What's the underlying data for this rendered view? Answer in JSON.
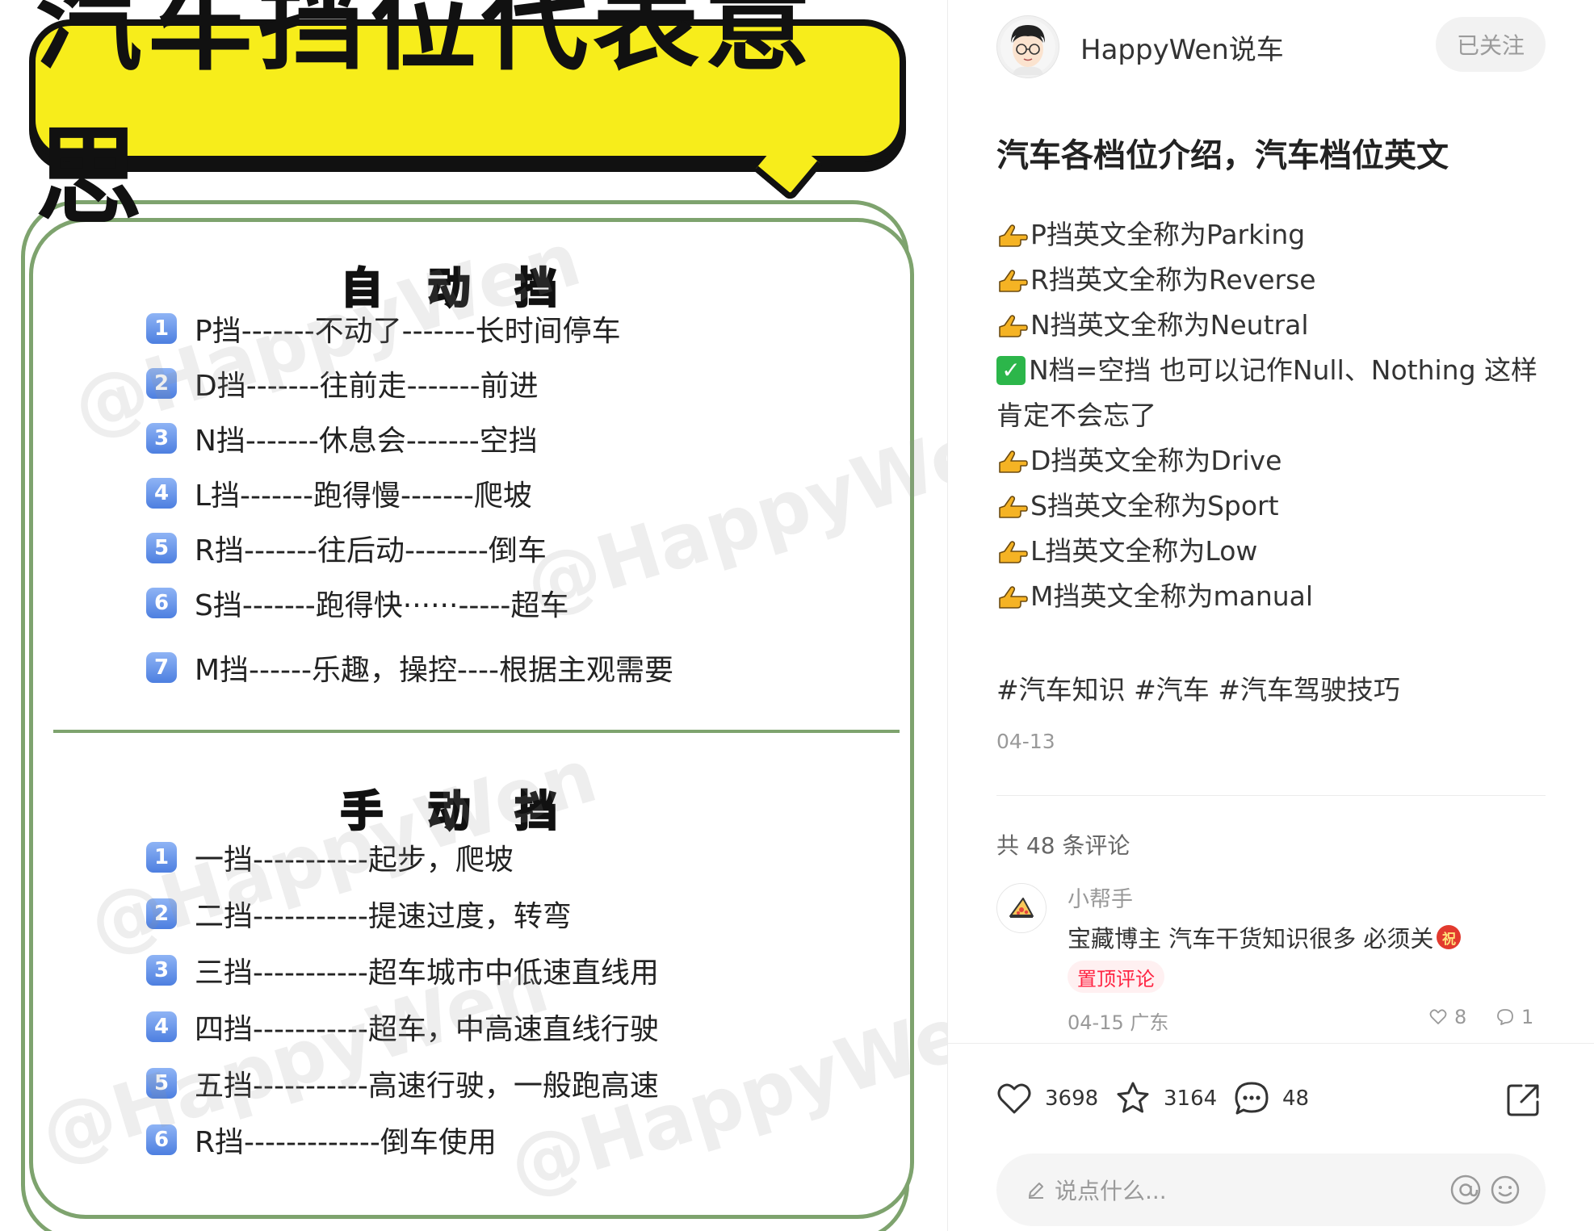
{
  "image": {
    "title": "汽车挡位代表意思",
    "watermark": "@HappyWen",
    "automatic": {
      "heading": "自动挡",
      "rows": [
        {
          "num": "1",
          "text": "P挡-------不动了-------长时间停车"
        },
        {
          "num": "2",
          "text": "D挡-------往前走-------前进"
        },
        {
          "num": "3",
          "text": "N挡-------休息会-------空挡"
        },
        {
          "num": "4",
          "text": "L挡-------跑得慢-------爬坡"
        },
        {
          "num": "5",
          "text": "R挡-------往后动--------倒车"
        },
        {
          "num": "6",
          "text": "S挡-------跑得快······-----超车"
        },
        {
          "num": "7",
          "text": "M挡------乐趣，操控----根据主观需要"
        }
      ]
    },
    "manual": {
      "heading": "手动挡",
      "rows": [
        {
          "num": "1",
          "text": "一挡-----------起步，爬坡"
        },
        {
          "num": "2",
          "text": "二挡-----------提速过度，转弯"
        },
        {
          "num": "3",
          "text": "三挡-----------超车城市中低速直线用"
        },
        {
          "num": "4",
          "text": "四挡-----------超车，中高速直线行驶"
        },
        {
          "num": "5",
          "text": "五挡-----------高速行驶，一般跑高速"
        },
        {
          "num": "6",
          "text": "R挡-------------倒车使用"
        }
      ]
    }
  },
  "post": {
    "author": "HappyWen说车",
    "follow_label": "已关注",
    "title": "汽车各档位介绍，汽车档位英文",
    "body": {
      "line1": "P挡英文全称为Parking",
      "line2": "R挡英文全称为Reverse",
      "line3": "N挡英文全称为Neutral",
      "line4a": "N档=空挡 也可以记作Null、Nothing 这样",
      "line4b": "肯定不会忘了",
      "line5": "D挡英文全称为Drive",
      "line6": "S挡英文全称为Sport",
      "line7": "L挡英文全称为Low",
      "line8": "M挡英文全称为manual"
    },
    "hashtags": "#汽车知识 #汽车 #汽车驾驶技巧",
    "date": "04-13"
  },
  "comments": {
    "count_label": "共 48 条评论",
    "items": [
      {
        "user": "小帮手",
        "text": "宝藏博主 汽车干货知识很多 必须关",
        "emoji_glyph": "祝",
        "badge": "置顶评论",
        "meta": "04-15 广东",
        "likes": "8",
        "replies": "1"
      }
    ]
  },
  "actions": {
    "likes": "3698",
    "collects": "3164",
    "comments": "48",
    "input_placeholder": "说点什么..."
  },
  "colors": {
    "banner_yellow": "#f7ed1b",
    "card_green": "#7ea36e",
    "badge_blue": "#4d7fe0",
    "accent_red": "#ff2442",
    "check_green": "#2cb64a"
  },
  "icons": {
    "pointing": "backhand-index-pointing-right-icon",
    "check": "check-mark-button-icon",
    "like": "heart-icon",
    "collect": "star-icon",
    "comment": "chat-bubble-icon",
    "share": "share-icon",
    "at": "at-sign-icon",
    "emoji": "smiley-icon",
    "pencil": "pencil-icon"
  }
}
